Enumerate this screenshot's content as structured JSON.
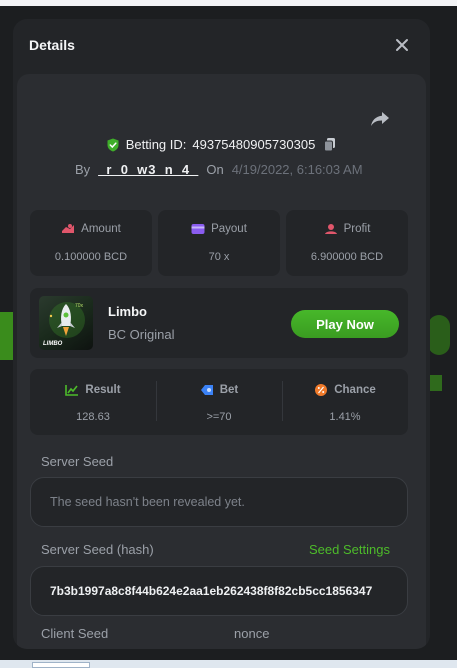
{
  "modal": {
    "title": "Details",
    "bet_label": "Betting ID:",
    "bet_id": "4937548090573030",
    "bet_id_suffix": "5",
    "by_label": "By",
    "user": "_r_0_w3_n_4_",
    "on_label": "On",
    "date": "4/19/2022, 6:16:03 AM"
  },
  "stats": {
    "amount_label": "Amount",
    "amount_value": "0.100000 BCD",
    "payout_label": "Payout",
    "payout_value": "70 x",
    "profit_label": "Profit",
    "profit_value": "6.900000 BCD"
  },
  "game": {
    "name": "Limbo",
    "provider": "BC Original",
    "play_label": "Play Now",
    "thumb_label": "LIMBO"
  },
  "result": {
    "result_label": "Result",
    "result_value": "128.63",
    "bet_label": "Bet",
    "bet_value": ">=70",
    "chance_label": "Chance",
    "chance_value": "1.41%"
  },
  "seeds": {
    "server_seed_label": "Server Seed",
    "server_seed_value": "The seed hasn't been revealed yet.",
    "server_hash_label": "Server Seed (hash)",
    "seed_settings_label": "Seed Settings",
    "server_hash_value": "7b3b1997a8c8f44b624e2aa1eb262438f8f82cb5cc1856347",
    "client_seed_label": "Client Seed",
    "nonce_label": "nonce"
  },
  "colors": {
    "accent_green": "#4dbb2a",
    "amount_icon": "#e0566b",
    "payout_icon": "#8a5cf0",
    "profit_icon": "#e0566b",
    "result_icon": "#4dbb2a",
    "bet_icon": "#3b82f6",
    "chance_icon": "#f07a2a"
  }
}
